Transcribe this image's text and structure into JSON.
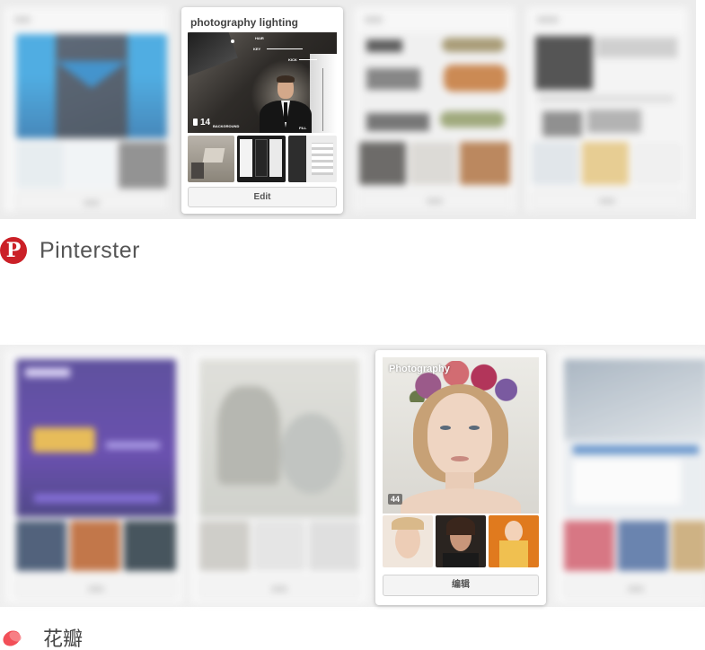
{
  "pinterest": {
    "brand_name": "Pinterster",
    "logo_glyph": "P",
    "brand_color": "#cb2027",
    "focused_board": {
      "title": "photography lighting",
      "pin_count": "14",
      "edit_label": "Edit",
      "pin_icon": "pin-icon",
      "light_labels": [
        "HAIR",
        "KEY",
        "KICK",
        "BACKGROUND",
        "FILL"
      ]
    }
  },
  "huaban": {
    "brand_name": "花瓣",
    "brand_color": "#f24f58",
    "focused_board": {
      "title": "Photography",
      "pin_count": "44",
      "edit_label": "编辑"
    }
  }
}
